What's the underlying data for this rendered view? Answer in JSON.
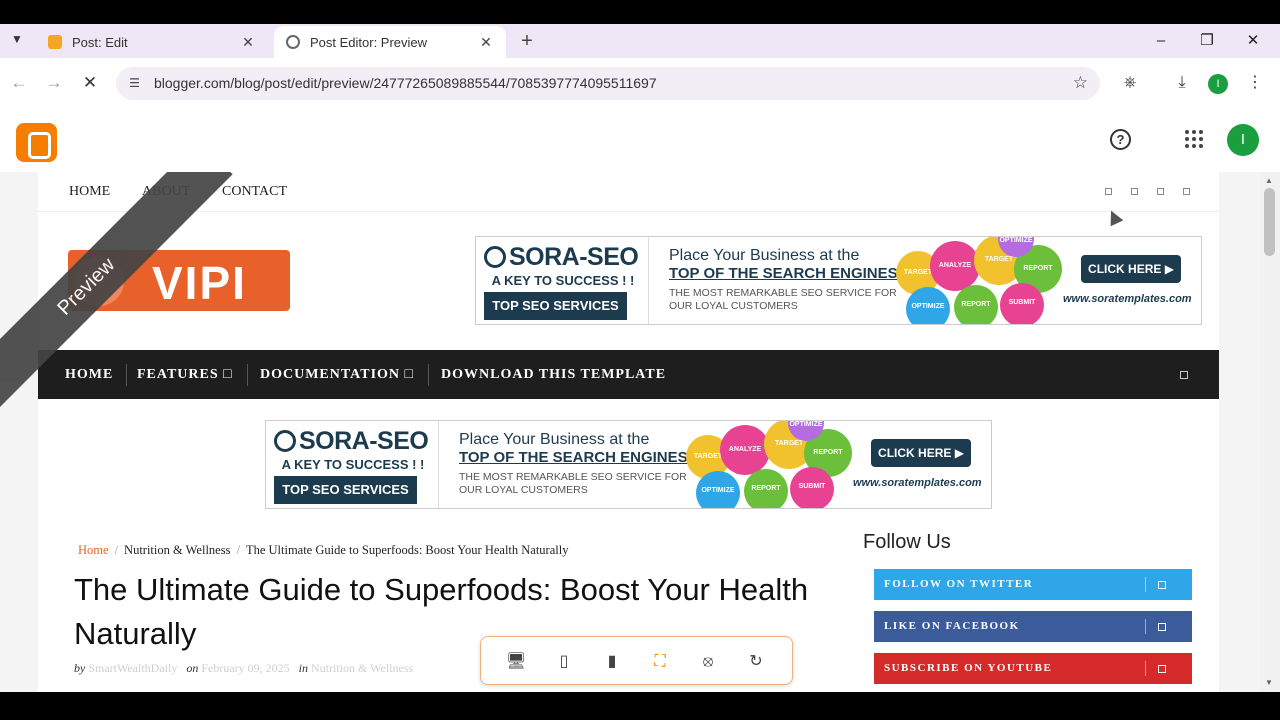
{
  "browser": {
    "tabs": [
      {
        "title": "Post: Edit",
        "icon": "blogger-favicon"
      },
      {
        "title": "Post Editor: Preview",
        "icon": "globe-favicon"
      }
    ],
    "url": "blogger.com/blog/post/edit/preview/2477726508988554​4/7085397774095511697",
    "profile_initial": "I"
  },
  "blogger": {
    "profile_initial": "I"
  },
  "site": {
    "top_menu": [
      "HOME",
      "ABOUT",
      "CONTACT"
    ],
    "logo_text": "VIPI",
    "preview_ribbon": "Preview",
    "ad": {
      "brand": "SORA-SEO",
      "tagline": "A KEY TO SUCCESS ! !",
      "service": "TOP SEO SERVICES",
      "headline": "Place Your Business at the",
      "headline_bold": "TOP OF THE SEARCH ENGINES",
      "subline": "THE MOST REMARKABLE SEO SERVICE FOR OUR LOYAL CUSTOMERS",
      "cta": "CLICK HERE",
      "website": "www.soratemplates.com",
      "bubbles": [
        "TARGET",
        "ANALYZE",
        "TARGET",
        "REPORT",
        "OPTIMIZE",
        "REPORT",
        "SUBMIT",
        "OPTIMIZE"
      ]
    },
    "main_menu": [
      "HOME",
      "FEATURES",
      "DOCUMENTATION",
      "DOWNLOAD THIS TEMPLATE"
    ],
    "breadcrumb": {
      "home": "Home",
      "category": "Nutrition & Wellness",
      "current": "The Ultimate Guide to Superfoods: Boost Your Health Naturally"
    },
    "post": {
      "title": "The Ultimate Guide to Superfoods: Boost Your Health Naturally",
      "by_label": "by",
      "author": "SmartWealthDaily",
      "on_label": "on",
      "date": "February 09, 2025",
      "in_label": "in",
      "category": "Nutrition & Wellness"
    },
    "sidebar": {
      "follow_title": "Follow Us",
      "buttons": [
        {
          "label": "FOLLOW ON TWITTER",
          "color": "#2ea6e8"
        },
        {
          "label": "LIKE ON FACEBOOK",
          "color": "#3b5b9a"
        },
        {
          "label": "SUBSCRIBE ON YOUTUBE",
          "color": "#d42a2a"
        }
      ]
    }
  }
}
